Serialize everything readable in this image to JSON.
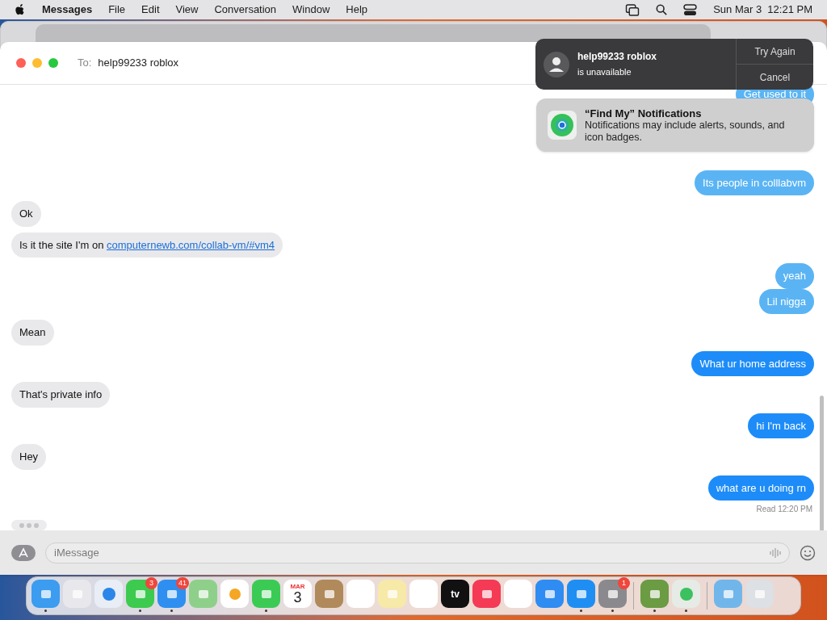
{
  "menu_bar": {
    "app": "Messages",
    "items": [
      "File",
      "Edit",
      "View",
      "Conversation",
      "Window",
      "Help"
    ],
    "clock": "Sun Mar 3  12:21 PM"
  },
  "conversation": {
    "to_label": "To:",
    "recipient": "help99233 roblox"
  },
  "messages": [
    {
      "kind": "sent",
      "text": "Get used to it",
      "color": "#5ab4f4"
    },
    {
      "kind": "sent",
      "text": "Its people in colllabvm",
      "color": "#5ab4f4"
    },
    {
      "kind": "received",
      "text": "Ok"
    },
    {
      "kind": "received",
      "text": "Is it the site I'm on ",
      "link": "computernewb.com/collab-vm/#vm4"
    },
    {
      "kind": "sent",
      "text": "yeah",
      "color": "#5ab4f4"
    },
    {
      "kind": "sent",
      "text": "Lil nigga",
      "color": "#5ab4f4"
    },
    {
      "kind": "received",
      "text": "Mean"
    },
    {
      "kind": "sent",
      "text": "What ur home address",
      "color": "#1d8cf8"
    },
    {
      "kind": "received",
      "text": "That's private info"
    },
    {
      "kind": "sent",
      "text": "hi I'm back",
      "color": "#1d8cf8"
    },
    {
      "kind": "received",
      "text": "Hey"
    },
    {
      "kind": "sent",
      "text": "what are u doing rn",
      "color": "#1d8cf8"
    }
  ],
  "read_receipt": "Read 12:20 PM",
  "typing_indicator": true,
  "compose": {
    "placeholder": "iMessage"
  },
  "alert": {
    "title": "help99233 roblox",
    "subtitle": "is unavailable",
    "buttons": [
      "Try Again",
      "Cancel"
    ]
  },
  "notification": {
    "title": "“Find My” Notifications",
    "body": "Notifications may include alerts, sounds, and icon badges."
  },
  "dock": [
    {
      "kind": "finder",
      "running": true
    },
    {
      "kind": "launchpad",
      "running": false
    },
    {
      "kind": "safari",
      "running": false
    },
    {
      "kind": "messages",
      "running": true,
      "badge": "3"
    },
    {
      "kind": "mail",
      "running": true,
      "badge": "41"
    },
    {
      "kind": "maps",
      "running": false
    },
    {
      "kind": "photos",
      "running": false
    },
    {
      "kind": "facetime",
      "running": true
    },
    {
      "kind": "calendar",
      "running": false,
      "month": "MAR",
      "day": "3"
    },
    {
      "kind": "contacts",
      "running": false
    },
    {
      "kind": "reminders",
      "running": false
    },
    {
      "kind": "notes",
      "running": false
    },
    {
      "kind": "freeform",
      "running": false
    },
    {
      "kind": "tv",
      "running": false,
      "label": "tv"
    },
    {
      "kind": "music",
      "running": false
    },
    {
      "kind": "news",
      "running": false
    },
    {
      "kind": "keynote",
      "running": false
    },
    {
      "kind": "appstore",
      "running": true
    },
    {
      "kind": "settings",
      "running": true,
      "badge": "1"
    },
    {
      "kind": "minecraft",
      "running": true,
      "divider_before": true
    },
    {
      "kind": "findmy",
      "running": true
    },
    {
      "kind": "downloads",
      "running": false,
      "divider_before": true
    },
    {
      "kind": "trash",
      "running": false
    }
  ]
}
